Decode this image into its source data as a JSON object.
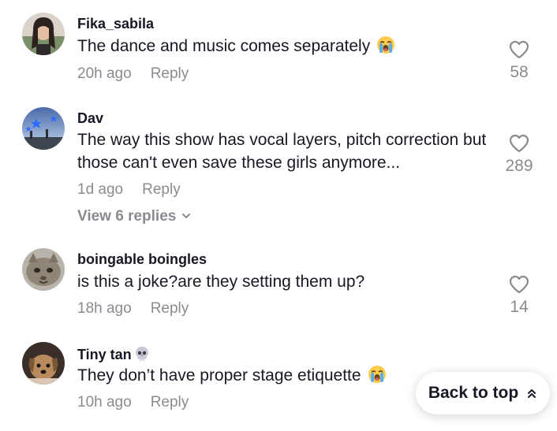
{
  "comments": [
    {
      "username": "Fika_sabila",
      "text": "The dance and music comes separately",
      "emoji": "loudly-crying-face-icon",
      "time": "20h ago",
      "reply_label": "Reply",
      "likes": "58"
    },
    {
      "username": "Dav",
      "text": "The way this show has vocal layers, pitch correction but those can't even save these girls anymore...",
      "time": "1d ago",
      "reply_label": "Reply",
      "likes": "289",
      "view_replies": "View 6 replies"
    },
    {
      "username": "boingable boingles",
      "text": "is this a joke?are they setting them up?",
      "time": "18h ago",
      "reply_label": "Reply",
      "likes": "14"
    },
    {
      "username": "Tiny tan",
      "username_emoji": "skull-icon",
      "text": "They don’t have proper stage etiquette",
      "emoji": "loudly-crying-face-icon",
      "time": "10h ago",
      "reply_label": "Reply"
    }
  ],
  "back_to_top": {
    "label": "Back to top",
    "icon": "double-chevron-up-icon"
  },
  "colors": {
    "text": "#161823",
    "muted": "#8a8b91",
    "background": "#ffffff"
  }
}
